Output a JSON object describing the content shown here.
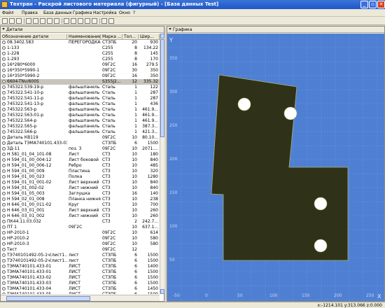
{
  "window": {
    "title": "Техтран - Раскрой листового материала (фигурный) - [База данных Test]",
    "minimize": "_",
    "restore": "▫",
    "close": "✕"
  },
  "menu": [
    "Файл",
    "Правка",
    "База данных",
    "Графика",
    "Настройка",
    "Окно",
    "?"
  ],
  "left_panel": {
    "title": "Детали",
    "columns": [
      "Обозначение детали",
      "Наименование",
      "Марка ...",
      "Тол...",
      "Шир..."
    ],
    "rows": [
      [
        "08.3402.583",
        "ПЕРЕГОРОДКА",
        "СТ3ПБ",
        "20",
        "930"
      ],
      [
        "1-133",
        "",
        "С255",
        "8",
        "134.22"
      ],
      [
        "1-228",
        "",
        "С255",
        "8",
        "145"
      ],
      [
        "1-293",
        "",
        "С255",
        "8",
        "170"
      ],
      [
        "16*280*6000",
        "",
        "09Г2С",
        "16",
        "279.5"
      ],
      [
        "16*350*5990-1",
        "",
        "09Г2С",
        "30",
        "350"
      ],
      [
        "16*350*5990-2",
        "",
        "09Г2С",
        "16",
        "350"
      ],
      [
        "6604-TNv/6005",
        "",
        "S355J2...",
        "12",
        "335.32"
      ],
      [
        "745322.539-19-р",
        "фальшпанель",
        "Сталь",
        "1",
        "122"
      ],
      [
        "745322.541-10-р",
        "фальшпанель",
        "Сталь",
        "1",
        "287"
      ],
      [
        "745322.541-11-р",
        "фальшпанель",
        "Сталь",
        "1",
        "287"
      ],
      [
        "745322.541-13-р",
        "фальшпанель",
        "Сталь",
        "1",
        "436"
      ],
      [
        "745322.563-р",
        "фальшпанель",
        "Сталь",
        "1",
        "461.9..."
      ],
      [
        "745322.563-01-р",
        "фальшпанель",
        "Сталь",
        "1",
        "461.9..."
      ],
      [
        "745322.564-р",
        "фальшпанель",
        "Сталь",
        "1",
        "461.9..."
      ],
      [
        "745322.565-р",
        "фальшпанель",
        "Сталь",
        "1",
        "387.3..."
      ],
      [
        "745322.566-р",
        "фальшпанель",
        "Сталь",
        "1",
        "421.3..."
      ],
      [
        "Деталь КВ119",
        "",
        "09Г2С",
        "10",
        "80.10..."
      ],
      [
        "Деталь ТЭМА740101.433-03",
        "",
        "СТ3ПБ",
        "6",
        "1500"
      ],
      [
        "ЗД-11",
        "поз. 3",
        "09Г2С",
        "10",
        "2071...."
      ],
      [
        "Н 581_01_04_101-08",
        "Лист",
        "СТ3",
        "10",
        "180"
      ],
      [
        "Н 594_01_00_004-12",
        "Лист боковой",
        "СТ3",
        "10",
        "840"
      ],
      [
        "Н 594_01_00_006-12",
        "Ребро",
        "СТ3",
        "10",
        "485"
      ],
      [
        "Н 594_01_00_009",
        "Пластина",
        "СТ3",
        "10",
        "320"
      ],
      [
        "Н 594_01_00_023",
        "Полка",
        "СТ3",
        "10",
        "1280"
      ],
      [
        "Н 594_01_01_001-02",
        "Лист верхний",
        "СТ3",
        "10",
        "840"
      ],
      [
        "Н 594_01_002-02",
        "Лист нижний",
        "СТ3",
        "10",
        "840"
      ],
      [
        "Н 594_01_05_003",
        "Заглушка",
        "СТ3",
        "16",
        "140"
      ],
      [
        "Н 594_02_01_008",
        "Планка нижняя",
        "СТ3",
        "10",
        "238"
      ],
      [
        "Н 646_01_00_011-02",
        "Круг",
        "СТ3",
        "10",
        "700"
      ],
      [
        "Н 646_03_01_001",
        "Лист верхний",
        "СТ3",
        "10",
        "260"
      ],
      [
        "Н 646_03_01_002",
        "Лист нижний",
        "СТ3",
        "10",
        "260"
      ],
      [
        "ПК44.11.03.032",
        "",
        "СТ3",
        "2",
        "242.7..."
      ],
      [
        "ПТ 1",
        "09Г2С",
        "",
        "10",
        "637.1..."
      ],
      [
        "НР-2010-1",
        "",
        "09Г2С",
        "10",
        "614"
      ],
      [
        "НР-2010-2",
        "",
        "09Г2С",
        "10",
        "580"
      ],
      [
        "НР-2010-3",
        "",
        "09Г2С",
        "10",
        "580"
      ],
      [
        "Тест",
        "",
        "09Г2С",
        "12",
        ""
      ],
      [
        "ТЭ740101492-05-1ч(лист1...",
        "лист",
        "СТ3ПБ",
        "6",
        "1500"
      ],
      [
        "ТЭ740101492-05-2ч(лист1...",
        "лист",
        "СТ3ПБ",
        "6",
        "1500"
      ],
      [
        "ТЭМА740101.433-01",
        "ЛИСТ",
        "СТ3ПБ",
        "6",
        "1400"
      ],
      [
        "ТЭМА740101.433-01",
        "ЛИСТ",
        "СТ3ПБ",
        "6",
        "1500"
      ],
      [
        "ТЭМА740101.433-02",
        "ЛИСТ",
        "СТ3ПБ",
        "6",
        "1500"
      ],
      [
        "ТЭМА740101.433-03",
        "ЛИСТ",
        "СТ3ПБ",
        "6",
        "1500"
      ],
      [
        "ТЭМА740101.433-04",
        "ЛИСТ",
        "СТ3ПБ",
        "6",
        "1450"
      ],
      [
        "ТЭМА740101.433-05",
        "ЛИСТ",
        "СТ3ПБ",
        "6",
        "1500"
      ],
      [
        "ТЭМА740101.433-06",
        "ЛИСТ",
        "СТ3ПБ",
        "6",
        "1500"
      ]
    ],
    "selected_row": 7
  },
  "right_panel": {
    "title": "Графика",
    "y_label": "Y",
    "x_label": "X",
    "y_ticks": [
      "350",
      "300",
      "250",
      "200",
      "150",
      "100",
      "50"
    ],
    "x_ticks": [
      "-50",
      "0",
      "50",
      "100",
      "150",
      "200",
      "250"
    ]
  },
  "colors": {
    "canvas_bg": "#4f7fd3",
    "part_fill": "#2f3218",
    "part_stroke": "#aab070",
    "hole_fill": "#ffffff",
    "grid": "#6f9ae0"
  },
  "status": {
    "coords": "x:-1214.101 y:313.066 z:0.000"
  }
}
